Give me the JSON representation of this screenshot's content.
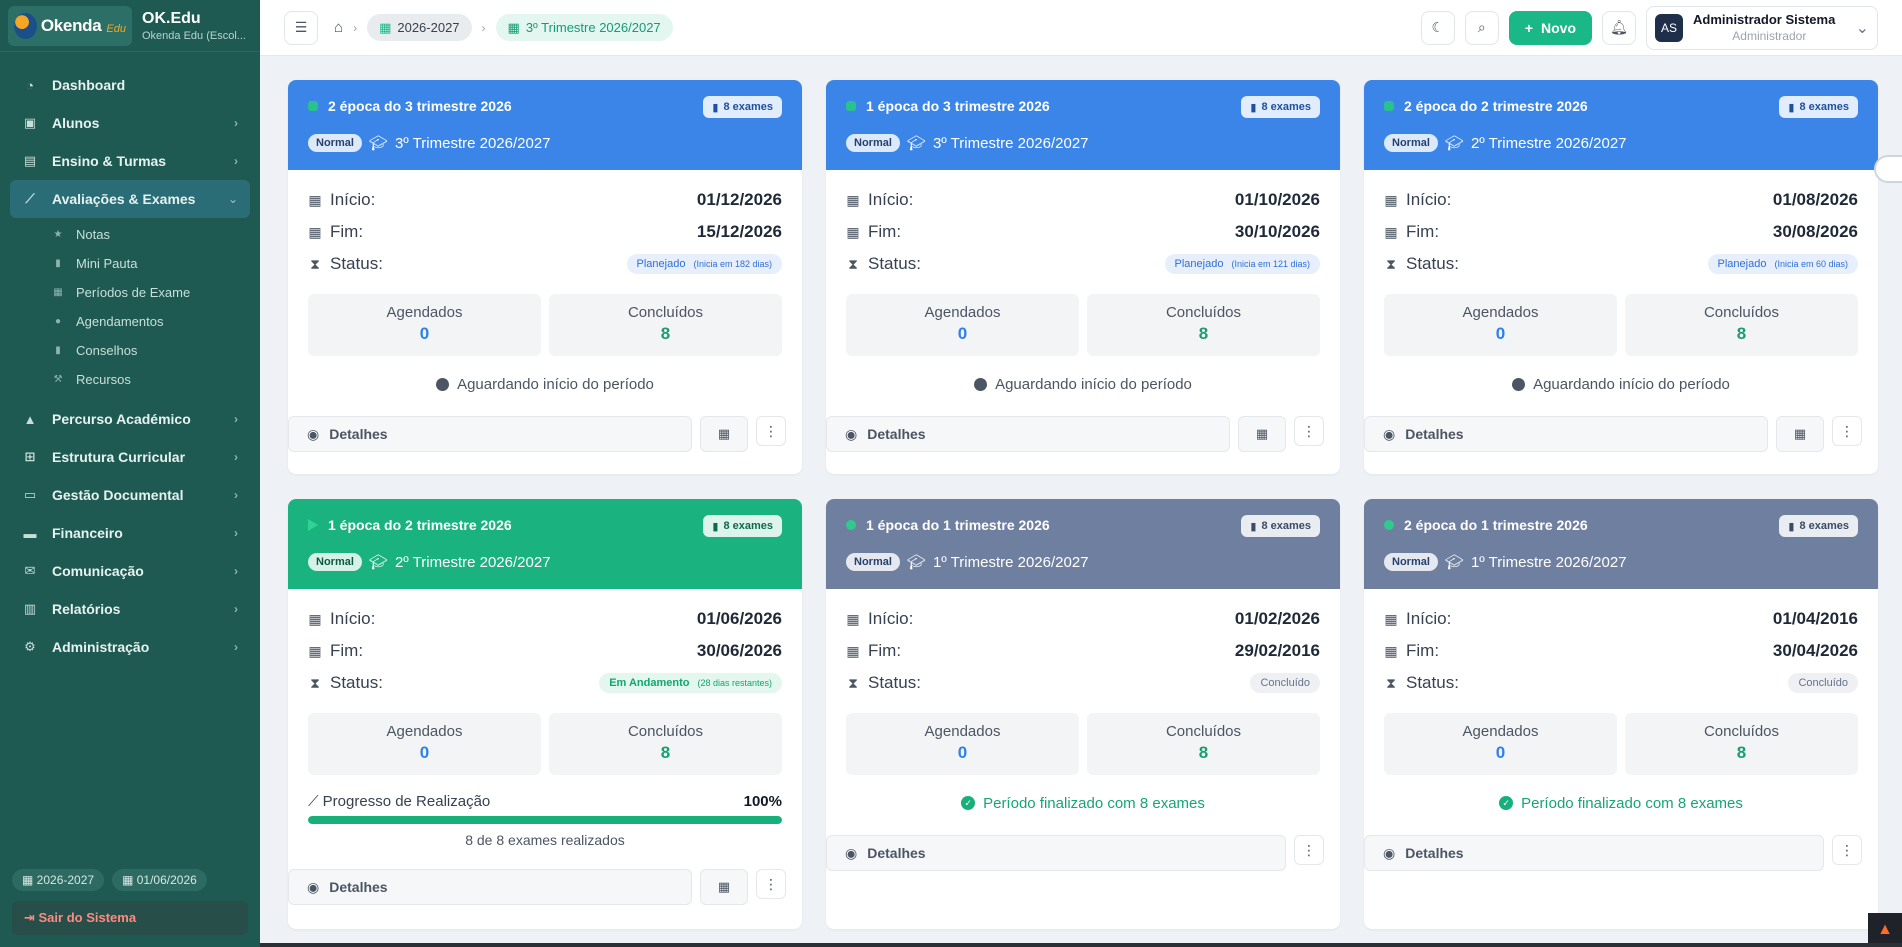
{
  "sidebar": {
    "logo_text": "Okenda",
    "logo_suffix": "Edu",
    "title": "OK.Edu",
    "subtitle": "Okenda Edu (Escol...",
    "items": [
      {
        "label": "Dashboard",
        "icon": "dashboard-icon"
      },
      {
        "label": "Alunos",
        "icon": "students-icon"
      },
      {
        "label": "Ensino & Turmas",
        "icon": "classes-icon"
      },
      {
        "label": "Avaliações & Exames",
        "icon": "chart-icon"
      },
      {
        "label": "Percurso Académico",
        "icon": "graduation-icon"
      },
      {
        "label": "Estrutura Curricular",
        "icon": "structure-icon"
      },
      {
        "label": "Gestão Documental",
        "icon": "folder-icon"
      },
      {
        "label": "Financeiro",
        "icon": "money-icon"
      },
      {
        "label": "Comunicação",
        "icon": "mail-icon"
      },
      {
        "label": "Relatórios",
        "icon": "report-icon"
      },
      {
        "label": "Administração",
        "icon": "gears-icon"
      }
    ],
    "subitems": [
      "Notas",
      "Mini Pauta",
      "Períodos de Exame",
      "Agendamentos",
      "Conselhos",
      "Recursos"
    ],
    "footer": {
      "year": "2026-2027",
      "date": "01/06/2026",
      "logout": "Sair do Sistema"
    }
  },
  "header": {
    "breadcrumb_year": "2026-2027",
    "breadcrumb_term": "3º Trimestre 2026/2027",
    "new_label": "Novo",
    "user_initials": "AS",
    "user_name": "Administrador Sistema",
    "user_role": "Administrador"
  },
  "labels": {
    "inicio": "Início:",
    "fim": "Fim:",
    "status": "Status:",
    "agendados": "Agendados",
    "concluidos": "Concluídos",
    "detalhes": "Detalhes",
    "normal": "Normal",
    "progress_title": "Progresso de Realização"
  },
  "colors": {
    "blue": "#3a85e7",
    "green": "#1ab37f",
    "slate": "#6f7f9f",
    "sidebar": "#1e5a52"
  },
  "cards": [
    {
      "title": "2 época do 3 trimestre 2026",
      "exams": "8 exames",
      "term": "3º Trimestre 2026/2027",
      "inicio": "01/12/2026",
      "fim": "15/12/2026",
      "status": "Planejado",
      "status_note": "(Inicia em 182 dias)",
      "agendados": "0",
      "concluidos": "8",
      "note": "Aguardando início do período"
    },
    {
      "title": "1 época do 3 trimestre 2026",
      "exams": "8 exames",
      "term": "3º Trimestre 2026/2027",
      "inicio": "01/10/2026",
      "fim": "30/10/2026",
      "status": "Planejado",
      "status_note": "(Inicia em 121 dias)",
      "agendados": "0",
      "concluidos": "8",
      "note": "Aguardando início do período"
    },
    {
      "title": "2 época do 2 trimestre 2026",
      "exams": "8 exames",
      "term": "2º Trimestre 2026/2027",
      "inicio": "01/08/2026",
      "fim": "30/08/2026",
      "status": "Planejado",
      "status_note": "(Inicia em 60 dias)",
      "agendados": "0",
      "concluidos": "8",
      "note": "Aguardando início do período"
    },
    {
      "title": "1 época do 2 trimestre 2026",
      "exams": "8 exames",
      "term": "2º Trimestre 2026/2027",
      "inicio": "01/06/2026",
      "fim": "30/06/2026",
      "status": "Em Andamento",
      "status_note": "(28 dias restantes)",
      "agendados": "0",
      "concluidos": "8",
      "progress_pct": "100%",
      "progress_value": 100,
      "progress_sub": "8 de 8 exames realizados"
    },
    {
      "title": "1 época do 1 trimestre 2026",
      "exams": "8 exames",
      "term": "1º Trimestre 2026/2027",
      "inicio": "01/02/2026",
      "fim": "29/02/2016",
      "status": "Concluído",
      "agendados": "0",
      "concluidos": "8",
      "note": "Período finalizado com 8 exames"
    },
    {
      "title": "2 época do 1 trimestre 2026",
      "exams": "8 exames",
      "term": "1º Trimestre 2026/2027",
      "inicio": "01/04/2016",
      "fim": "30/04/2026",
      "status": "Concluído",
      "agendados": "0",
      "concluidos": "8",
      "note": "Período finalizado com 8 exames"
    }
  ]
}
